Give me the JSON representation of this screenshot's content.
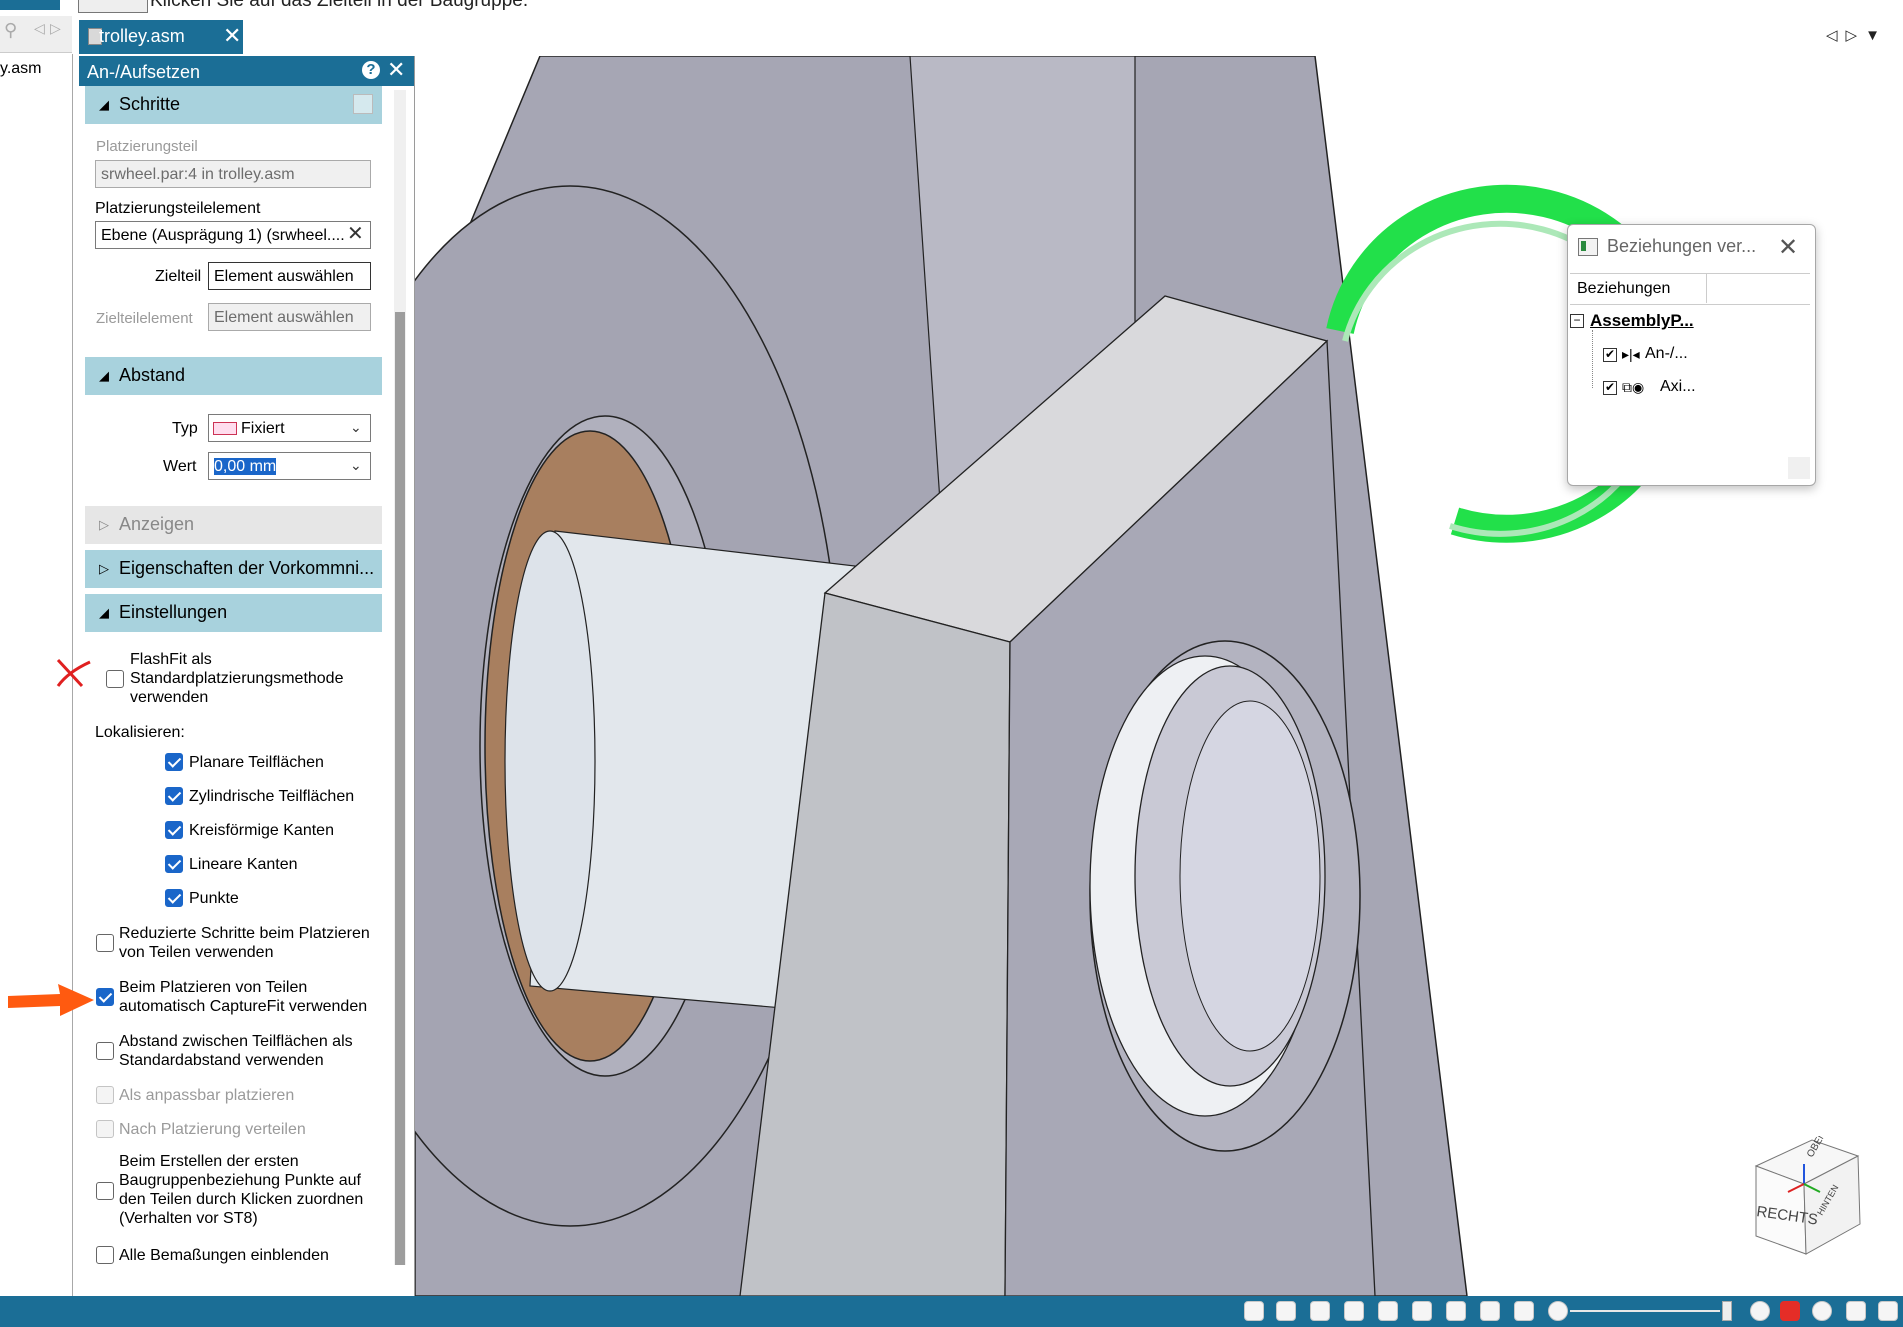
{
  "prompt": "Klicken Sie auf das Zielteil in der Baugruppe.",
  "left_pane": {
    "file_label": "y.asm"
  },
  "tab": {
    "label": "trolley.asm"
  },
  "panel": {
    "title": "An-/Aufsetzen",
    "steps": {
      "header": "Schritte",
      "placement_part_label": "Platzierungsteil",
      "placement_part_value": "srwheel.par:4 in trolley.asm",
      "placement_element_label": "Platzierungsteilelement",
      "placement_element_value": "Ebene (Ausprägung 1) (srwheel....",
      "target_part_label": "Zielteil",
      "target_part_value": "Element auswählen",
      "target_element_label": "Zielteilelement",
      "target_element_value": "Element auswählen"
    },
    "distance": {
      "header": "Abstand",
      "type_label": "Typ",
      "type_value": "Fixiert",
      "value_label": "Wert",
      "value_value": "0,00 mm"
    },
    "display": {
      "header": "Anzeigen"
    },
    "occurrence": {
      "header": "Eigenschaften der Vorkommni..."
    },
    "settings": {
      "header": "Einstellungen",
      "flashfit": {
        "line1": "FlashFit als",
        "line2": "Standardplatzierungsmethode",
        "line3": "verwenden"
      },
      "locate_label": "Lokalisieren:",
      "locate_items": [
        "Planare Teilflächen",
        "Zylindrische Teilflächen",
        "Kreisförmige Kanten",
        "Lineare Kanten",
        "Punkte"
      ],
      "reduced_steps": {
        "line1": "Reduzierte Schritte beim Platzieren",
        "line2": "von Teilen verwenden"
      },
      "capturefit": {
        "line1": "Beim Platzieren von Teilen",
        "line2": "automatisch CaptureFit verwenden"
      },
      "face_distance": {
        "line1": "Abstand zwischen Teilflächen als",
        "line2": "Standardabstand verwenden"
      },
      "adjustable": "Als anpassbar platzieren",
      "distribute": "Nach Platzierung verteilen",
      "first_relation": {
        "line1": "Beim Erstellen der ersten",
        "line2": "Baugruppenbeziehung Punkte auf",
        "line3": "den Teilen durch Klicken zuordnen",
        "line4": "(Verhalten vor ST8)"
      },
      "show_dims": "Alle Bemaßungen einblenden"
    }
  },
  "relations": {
    "title": "Beziehungen ver...",
    "column": "Beziehungen",
    "root": "AssemblyP...",
    "items": [
      "An-/...",
      "Axi..."
    ]
  },
  "cube": {
    "face_front": "RECHTS",
    "face_top": "OBEN",
    "face_side": "HINTEN"
  },
  "colors": {
    "accent": "#1b6e96",
    "section": "#a8d2dd",
    "checkbox": "#1a66c9",
    "green_ring": "#22e04a",
    "part_grey": "#a6a6b4",
    "bronze": "#a87f5f"
  }
}
